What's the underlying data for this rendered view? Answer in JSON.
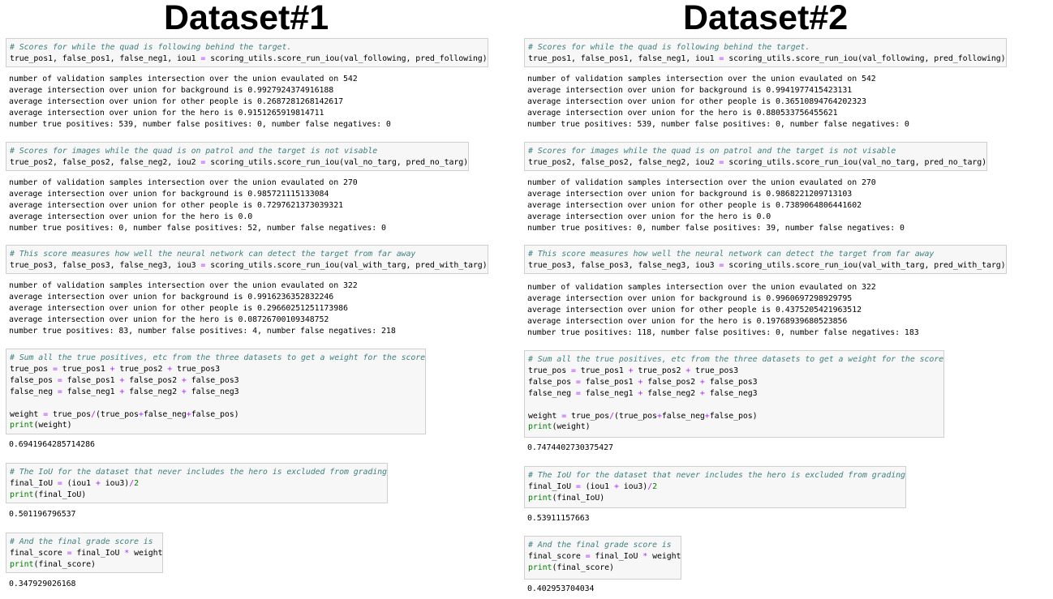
{
  "headers": {
    "left": "Dataset#1",
    "right": "Dataset#2"
  },
  "common": {
    "c1_comment": "# Scores for while the quad is following behind the target.",
    "c1_vars": "true_pos1, false_pos1, false_neg1, iou1",
    "c1_call": "scoring_utils.score_run_iou(val_following, pred_following)",
    "c2_comment": "# Scores for images while the quad is on patrol and the target is not visable",
    "c2_vars": "true_pos2, false_pos2, false_neg2, iou2",
    "c2_call": "scoring_utils.score_run_iou(val_no_targ, pred_no_targ)",
    "c3_comment": "# This score measures how well the neural network can detect the target from far away",
    "c3_vars": "true_pos3, false_pos3, false_neg3, iou3",
    "c3_call": "scoring_utils.score_run_iou(val_with_targ, pred_with_targ)",
    "c4_comment": "# Sum all the true positives, etc from the three datasets to get a weight for the score",
    "c4_tp_lhs": "true_pos",
    "c4_tp_a": "true_pos1",
    "c4_tp_b": "true_pos2",
    "c4_tp_c": "true_pos3",
    "c4_fp_lhs": "false_pos",
    "c4_fp_a": "false_pos1",
    "c4_fp_b": "false_pos2",
    "c4_fp_c": "false_pos3",
    "c4_fn_lhs": "false_neg",
    "c4_fn_a": "false_neg1",
    "c4_fn_b": "false_neg2",
    "c4_fn_c": "false_neg3",
    "c4_w_lhs": "weight",
    "c4_w_a": "true_pos",
    "c4_w_b": "(true_pos",
    "c4_w_c": "false_neg",
    "c4_w_d": "false_pos)",
    "c4_print": "print",
    "c4_print_arg": "(weight)",
    "c5_comment": "# The IoU for the dataset that never includes the hero is excluded from grading",
    "c5_lhs": "final_IoU",
    "c5_a": "(iou1",
    "c5_b": "iou3)",
    "c5_div": "2",
    "c5_print": "print",
    "c5_print_arg": "(final_IoU)",
    "c6_comment": "# And the final grade score is",
    "c6_lhs": "final_score",
    "c6_a": "final_IoU",
    "c6_b": "weight",
    "c6_print": "print",
    "c6_print_arg": "(final_score)"
  },
  "left": {
    "out1": "number of validation samples intersection over the union evaulated on 542\naverage intersection over union for background is 0.9927924374916188\naverage intersection over union for other people is 0.2687281268142617\naverage intersection over union for the hero is 0.9151265919814711\nnumber true positives: 539, number false positives: 0, number false negatives: 0",
    "out2": "number of validation samples intersection over the union evaulated on 270\naverage intersection over union for background is 0.985721115133084\naverage intersection over union for other people is 0.7297621373039321\naverage intersection over union for the hero is 0.0\nnumber true positives: 0, number false positives: 52, number false negatives: 0",
    "out3": "number of validation samples intersection over the union evaulated on 322\naverage intersection over union for background is 0.9916236352832246\naverage intersection over union for other people is 0.29660251251173986\naverage intersection over union for the hero is 0.08726700109348752\nnumber true positives: 83, number false positives: 4, number false negatives: 218",
    "out4": "0.6941964285714286",
    "out5": "0.501196796537",
    "out6": "0.347929026168"
  },
  "right": {
    "out1": "number of validation samples intersection over the union evaulated on 542\naverage intersection over union for background is 0.9941977415423131\naverage intersection over union for other people is 0.36510894764202323\naverage intersection over union for the hero is 0.880533756455621\nnumber true positives: 539, number false positives: 0, number false negatives: 0",
    "out2": "number of validation samples intersection over the union evaulated on 270\naverage intersection over union for background is 0.9868221209713103\naverage intersection over union for other people is 0.7389064806441602\naverage intersection over union for the hero is 0.0\nnumber true positives: 0, number false positives: 39, number false negatives: 0",
    "out3": "number of validation samples intersection over the union evaulated on 322\naverage intersection over union for background is 0.9960697298929795\naverage intersection over union for other people is 0.4375205421963512\naverage intersection over union for the hero is 0.19768939680523856\nnumber true positives: 118, number false positives: 0, number false negatives: 183",
    "out4": "0.7474402730375427",
    "out5": "0.53911157663",
    "out6": "0.402953704034"
  },
  "colors": {
    "comment": "#408080",
    "operator": "#aa22ff",
    "number": "#008000",
    "cell_bg": "#f7f7f7"
  }
}
